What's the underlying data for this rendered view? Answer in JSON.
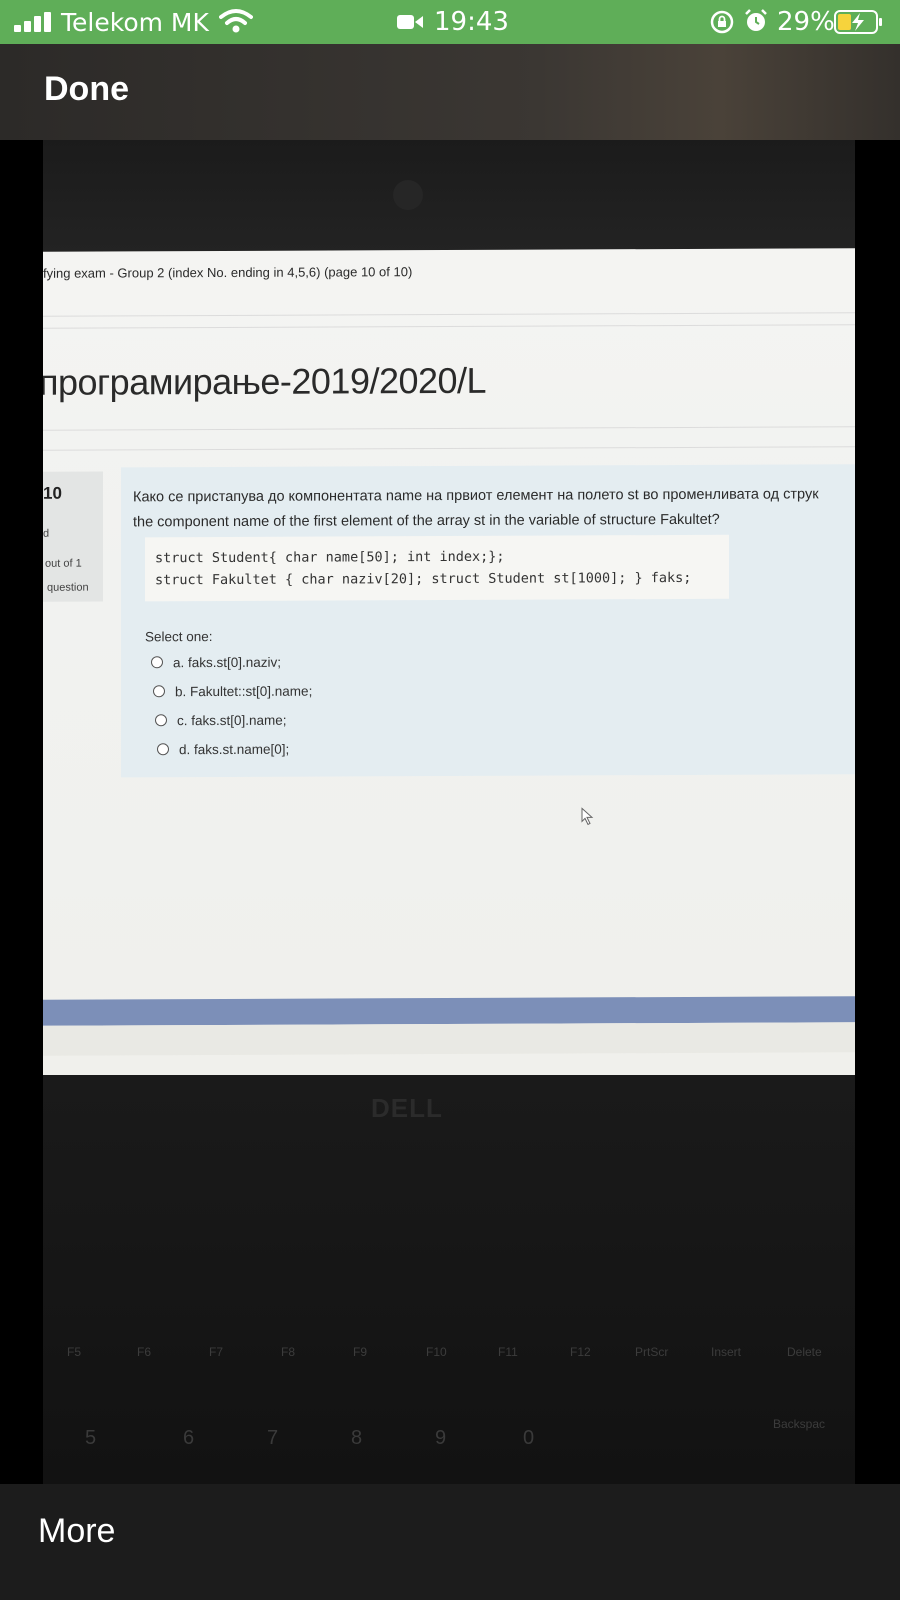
{
  "status_bar": {
    "carrier": "Telekom MK",
    "time": "19:43",
    "battery_percent": "29%"
  },
  "top_bar": {
    "done_label": "Done"
  },
  "photo": {
    "breadcrumb": "fying exam - Group 2 (index No. ending in 4,5,6) (page 10 of 10)",
    "course_title": "програмирање-2019/2020/L",
    "question_info": {
      "number": "10",
      "state": "d",
      "mark": "out of 1",
      "flag": "question"
    },
    "question_text_line1": "Како се пристапува до компонентата name на првиот елемент на полето st во променливата од струк",
    "question_text_line2": "the component name of the first element of the array st in the variable of structure Fakultet?",
    "code_line1": "struct Student{ char name[50]; int index;};",
    "code_line2": "struct Fakultet { char naziv[20]; struct Student st[1000]; } faks;",
    "select_one": "Select one:",
    "options": [
      "a. faks.st[0].naziv;",
      "b. Fakultet::st[0].name;",
      "c. faks.st[0].name;",
      "d. faks.st.name[0];"
    ],
    "keyboard": {
      "brand": "DELL",
      "fn_keys": [
        "F5",
        "F6",
        "F7",
        "F8",
        "F9",
        "F10",
        "F11",
        "F12",
        "PrtScr",
        "Insert",
        "Delete"
      ],
      "num_keys": [
        "5",
        "6",
        "7",
        "8",
        "9",
        "0"
      ],
      "backspace": "Backspac"
    }
  },
  "bottom_bar": {
    "more_label": "More"
  }
}
